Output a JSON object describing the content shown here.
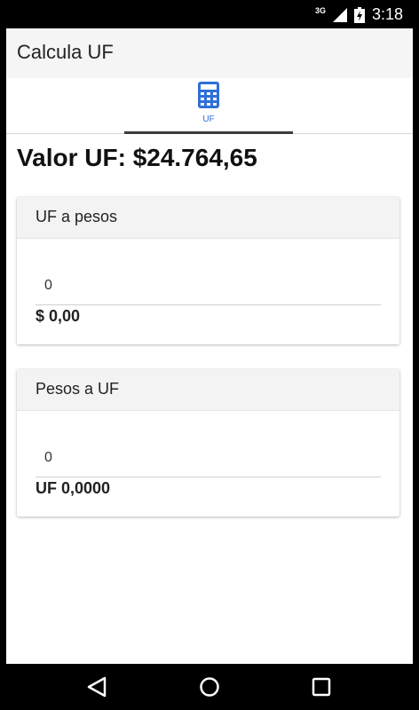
{
  "status_bar": {
    "network": "3G",
    "time": "3:18"
  },
  "app_bar": {
    "title": "Calcula UF"
  },
  "tabs": [
    {
      "label": "UF",
      "icon": "calculator-icon",
      "active": true
    }
  ],
  "rate": {
    "text": "Valor UF: $24.764,65"
  },
  "card_uf_to_pesos": {
    "title": "UF a pesos",
    "input_value": "0",
    "result": "$ 0,00"
  },
  "card_pesos_to_uf": {
    "title": "Pesos a UF",
    "input_value": "0",
    "result": "UF 0,0000"
  },
  "nav_bar": {
    "buttons": [
      "back-icon",
      "home-icon",
      "recents-icon"
    ]
  },
  "colors": {
    "accent": "#2f6fd8",
    "indicator": "#3c3c3c",
    "appbar": "#f5f5f5"
  }
}
